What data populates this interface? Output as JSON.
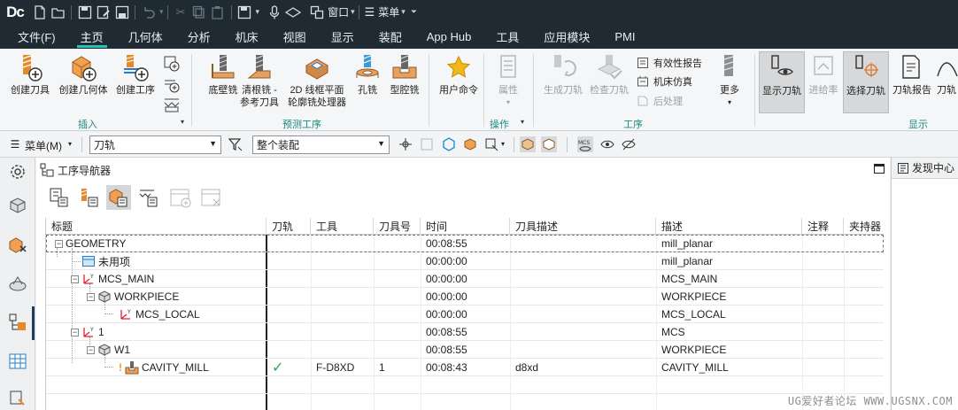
{
  "app": {
    "logo": "Dc",
    "window_menu": "窗口",
    "menu_label": "菜单"
  },
  "tabs": [
    "文件(F)",
    "主页",
    "几何体",
    "分析",
    "机床",
    "视图",
    "显示",
    "装配",
    "App Hub",
    "工具",
    "应用模块",
    "PMI"
  ],
  "active_tab": "主页",
  "ribbon": {
    "insert": {
      "create_tool": "创建刀具",
      "create_geometry": "创建几何体",
      "create_operation": "创建工序",
      "group_label": "插入"
    },
    "predict": {
      "wall_mill": "底壁铣",
      "rest_mill_line1": "清根铣 -",
      "rest_mill_line2": "参考刀具",
      "planar_line1": "2D 线框平面",
      "planar_line2": "轮廓铣处理器",
      "hole_mill": "孔铣",
      "cavity_mill": "型腔铣",
      "group_label": "预测工序"
    },
    "user_cmd": "用户命令",
    "operate": {
      "properties": "属性",
      "group_label": "操作"
    },
    "operation": {
      "generate": "生成刀轨",
      "verify": "检查刀轨",
      "validity_report": "有效性报告",
      "machine_sim": "机床仿真",
      "post_process": "后处理",
      "more": "更多",
      "group_label": "工序"
    },
    "display": {
      "show_toolpath": "显示刀轨",
      "feedrate": "进给率",
      "select_toolpath": "选择刀轨",
      "toolpath_report": "刀轨报告",
      "toolpath_label": "刀轨",
      "group_label": "显示"
    }
  },
  "filterbar": {
    "menu": "菜单(M)",
    "type_filter": "刀轨",
    "scope": "整个装配"
  },
  "navigator": {
    "title": "工序导航器",
    "columns": [
      "标题",
      "刀轨",
      "工具",
      "刀具号",
      "时间",
      "刀具描述",
      "描述",
      "注释",
      "夹持器"
    ],
    "rows": [
      {
        "title": "GEOMETRY",
        "toolpath": "",
        "tool": "",
        "tool_no": "",
        "time": "00:08:55",
        "tool_desc": "",
        "desc": "mill_planar"
      },
      {
        "title": "未用项",
        "toolpath": "",
        "tool": "",
        "tool_no": "",
        "time": "00:00:00",
        "tool_desc": "",
        "desc": "mill_planar"
      },
      {
        "title": "MCS_MAIN",
        "toolpath": "",
        "tool": "",
        "tool_no": "",
        "time": "00:00:00",
        "tool_desc": "",
        "desc": "MCS_MAIN"
      },
      {
        "title": "WORKPIECE",
        "toolpath": "",
        "tool": "",
        "tool_no": "",
        "time": "00:00:00",
        "tool_desc": "",
        "desc": "WORKPIECE"
      },
      {
        "title": "MCS_LOCAL",
        "toolpath": "",
        "tool": "",
        "tool_no": "",
        "time": "00:00:00",
        "tool_desc": "",
        "desc": "MCS_LOCAL"
      },
      {
        "title": "1",
        "toolpath": "",
        "tool": "",
        "tool_no": "",
        "time": "00:08:55",
        "tool_desc": "",
        "desc": "MCS"
      },
      {
        "title": "W1",
        "toolpath": "",
        "tool": "",
        "tool_no": "",
        "time": "00:08:55",
        "tool_desc": "",
        "desc": "WORKPIECE"
      },
      {
        "title": "CAVITY_MILL",
        "toolpath": "✓",
        "tool": "F-D8XD",
        "tool_no": "1",
        "time": "00:08:43",
        "tool_desc": "d8xd",
        "desc": "CAVITY_MILL"
      }
    ]
  },
  "right_panel": {
    "title": "发现中心"
  },
  "watermark": "UG爱好者论坛 WWW.UGSNX.COM",
  "colors": {
    "titlebar": "#1f2a33",
    "accent": "#2ac0b3",
    "check": "#2aa84a",
    "group_label": "#1a8a80"
  }
}
